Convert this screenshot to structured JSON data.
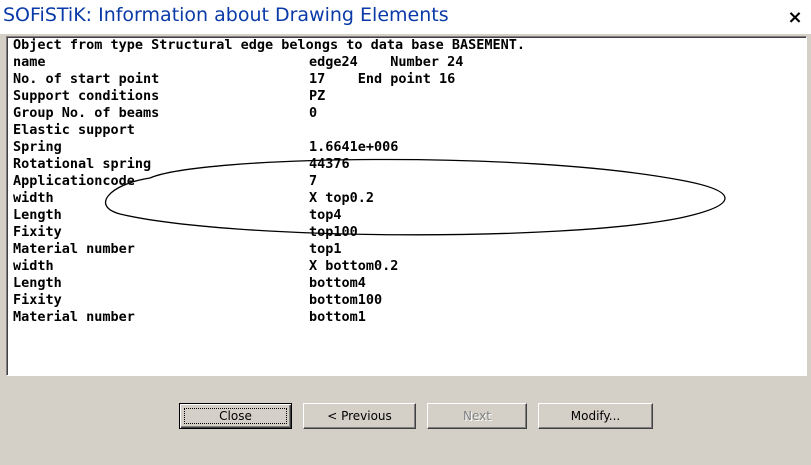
{
  "window": {
    "title": "SOFiSTiK: Information about Drawing Elements",
    "close_glyph": "×"
  },
  "info_list": {
    "header": "Object from type Structural edge belongs to data base BASEMENT.",
    "rows": [
      {
        "label": "name",
        "value": "edge24    Number 24"
      },
      {
        "label": "No. of start point",
        "value": "17    End point 16"
      },
      {
        "label": "Support conditions",
        "value": "PZ"
      },
      {
        "label": "Group No. of beams",
        "value": "0"
      },
      {
        "label": "Elastic support",
        "value": ""
      },
      {
        "label": "Spring",
        "value": "1.6641e+006"
      },
      {
        "label": "Rotational spring",
        "value": "44376"
      },
      {
        "label": "Applicationcode",
        "value": "7"
      },
      {
        "label": "width",
        "value": "X top0.2"
      },
      {
        "label": "Length",
        "value": "top4"
      },
      {
        "label": "Fixity",
        "value": "top100"
      },
      {
        "label": "Material number",
        "value": "top1"
      },
      {
        "label": "width",
        "value": "X bottom0.2"
      },
      {
        "label": "Length",
        "value": "bottom4"
      },
      {
        "label": "Fixity",
        "value": "bottom100"
      },
      {
        "label": "Material number",
        "value": "bottom1"
      }
    ]
  },
  "buttons": {
    "close": "Close",
    "previous": "< Previous",
    "next": "Next",
    "modify": "Modify..."
  },
  "annotation": {
    "shape": "hand-drawn ellipse",
    "stroke_color": "#000000"
  }
}
